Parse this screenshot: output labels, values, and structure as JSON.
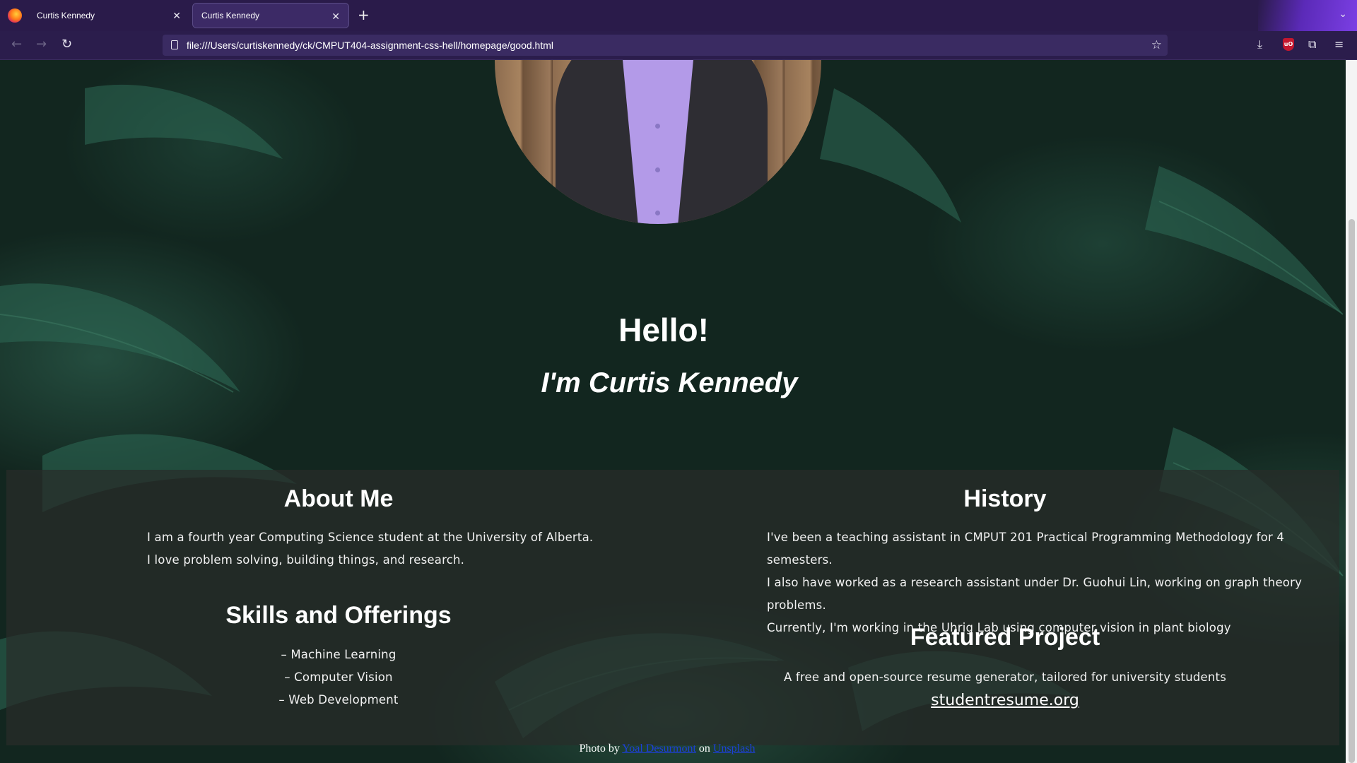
{
  "browser": {
    "tabs": [
      {
        "title": "Curtis Kennedy",
        "active": false
      },
      {
        "title": "Curtis Kennedy",
        "active": true
      }
    ],
    "url": "file:///Users/curtiskennedy/ck/CMPUT404-assignment-css-hell/homepage/good.html",
    "ublock_badge": "uO"
  },
  "hero": {
    "greeting": "Hello!",
    "intro": "I'm Curtis Kennedy"
  },
  "about": {
    "title": "About Me",
    "lines": [
      "I am a fourth year Computing Science student at the University of Alberta.",
      "I love problem solving, building things, and research."
    ]
  },
  "skills": {
    "title": "Skills and Offerings",
    "items": [
      "– Machine Learning",
      "– Computer Vision",
      "– Web Development"
    ]
  },
  "history": {
    "title": "History",
    "lines": [
      "I've been a teaching assistant in CMPUT 201 Practical Programming Methodology for 4 semesters.",
      "I also have worked as a research assistant under Dr. Guohui Lin, working on graph theory problems.",
      "Currently, I'm working in the Uhrig Lab using computer vision in plant biology"
    ]
  },
  "featured": {
    "title": "Featured Project",
    "description": "A free and open-source resume generator, tailored for university students",
    "link": "studentresume.org"
  },
  "credit": {
    "prefix": "Photo by",
    "author": "Yoal Desurmont",
    "middle": "on",
    "site": "Unsplash"
  }
}
